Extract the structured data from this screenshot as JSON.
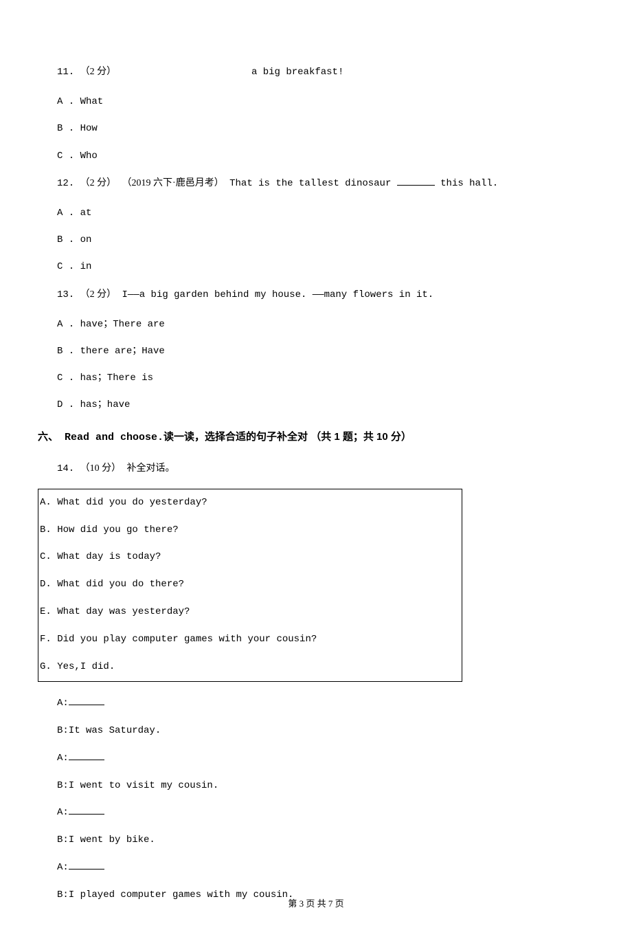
{
  "q11": {
    "num": "11.",
    "points": "（2 分）",
    "text": "a big breakfast!",
    "opts": {
      "A": "A . What",
      "B": "B . How",
      "C": "C . Who"
    }
  },
  "q12": {
    "num": "12.",
    "points": "（2 分）",
    "context": "（2019 六下·鹿邑月考）",
    "text_before": "That is the tallest dinosaur ",
    "text_after": " this hall.",
    "opts": {
      "A": "A . at",
      "B": "B . on",
      "C": "C . in"
    }
  },
  "q13": {
    "num": "13.",
    "points": "（2 分）",
    "text": " I——a big garden behind my house. ——many flowers in it.",
    "opts": {
      "A": "A . have；There are",
      "B": "B . there are；Have",
      "C": "C . has；There is",
      "D": "D . has；have"
    }
  },
  "section6": {
    "num": "六、",
    "title_mono": " Read and choose.",
    "title_cn": "读一读，选择合适的句子补全对 （共 1 题；共 10 分）"
  },
  "q14": {
    "num": "14.",
    "points": "（10 分）",
    "text": " 补全对话。",
    "box": {
      "A": "A. What did you do yesterday?",
      "B": "B. How did you go there?",
      "C": "C. What day is today?",
      "D": "D. What did you do there?",
      "E": "E. What day was yesterday?",
      "F": "F. Did you play computer games with your cousin?",
      "G": "G. Yes,I did."
    },
    "dialogue": {
      "a1": "A:",
      "b1": "B:It was Saturday.",
      "a2": "A:",
      "b2": "B:I went to visit my cousin.",
      "a3": "A:",
      "b3": "B:I went by bike.",
      "a4": "A:",
      "b4": "B:I played computer games with my cousin."
    }
  },
  "footer": "第 3 页 共 7 页"
}
